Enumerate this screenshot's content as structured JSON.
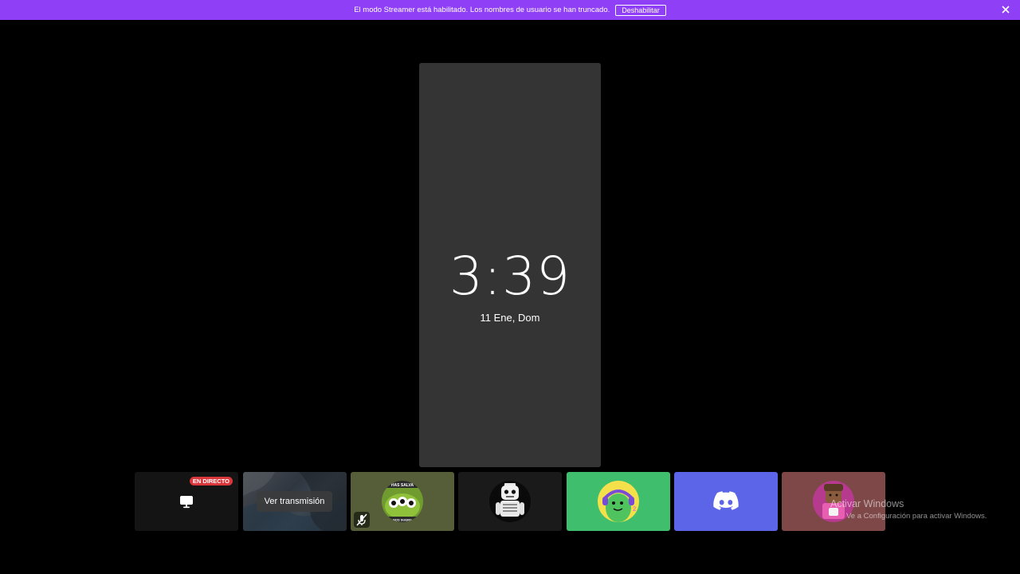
{
  "banner": {
    "message": "El modo Streamer está habilitado. Los nombres de usuario se han truncado.",
    "disable_label": "Deshabilitar",
    "close_icon": "close-icon",
    "color": "#8f3ff5"
  },
  "stream": {
    "time": "3:39",
    "date": "11 Ene, Dom"
  },
  "tiles": {
    "live_badge": "EN DIRECTO",
    "live_icon": "monitor-icon",
    "watch_label": "Ver transmisión",
    "avatar3_caption_top": "HAS SALVA",
    "avatar3_caption_bottom": "NOS SUERG",
    "muted_icon": "microphone-off-icon",
    "discord_icon": "discord-logo-icon"
  },
  "watermark": {
    "title": "Activar Windows",
    "subtitle": "Ve a Configuración para activar Windows."
  }
}
